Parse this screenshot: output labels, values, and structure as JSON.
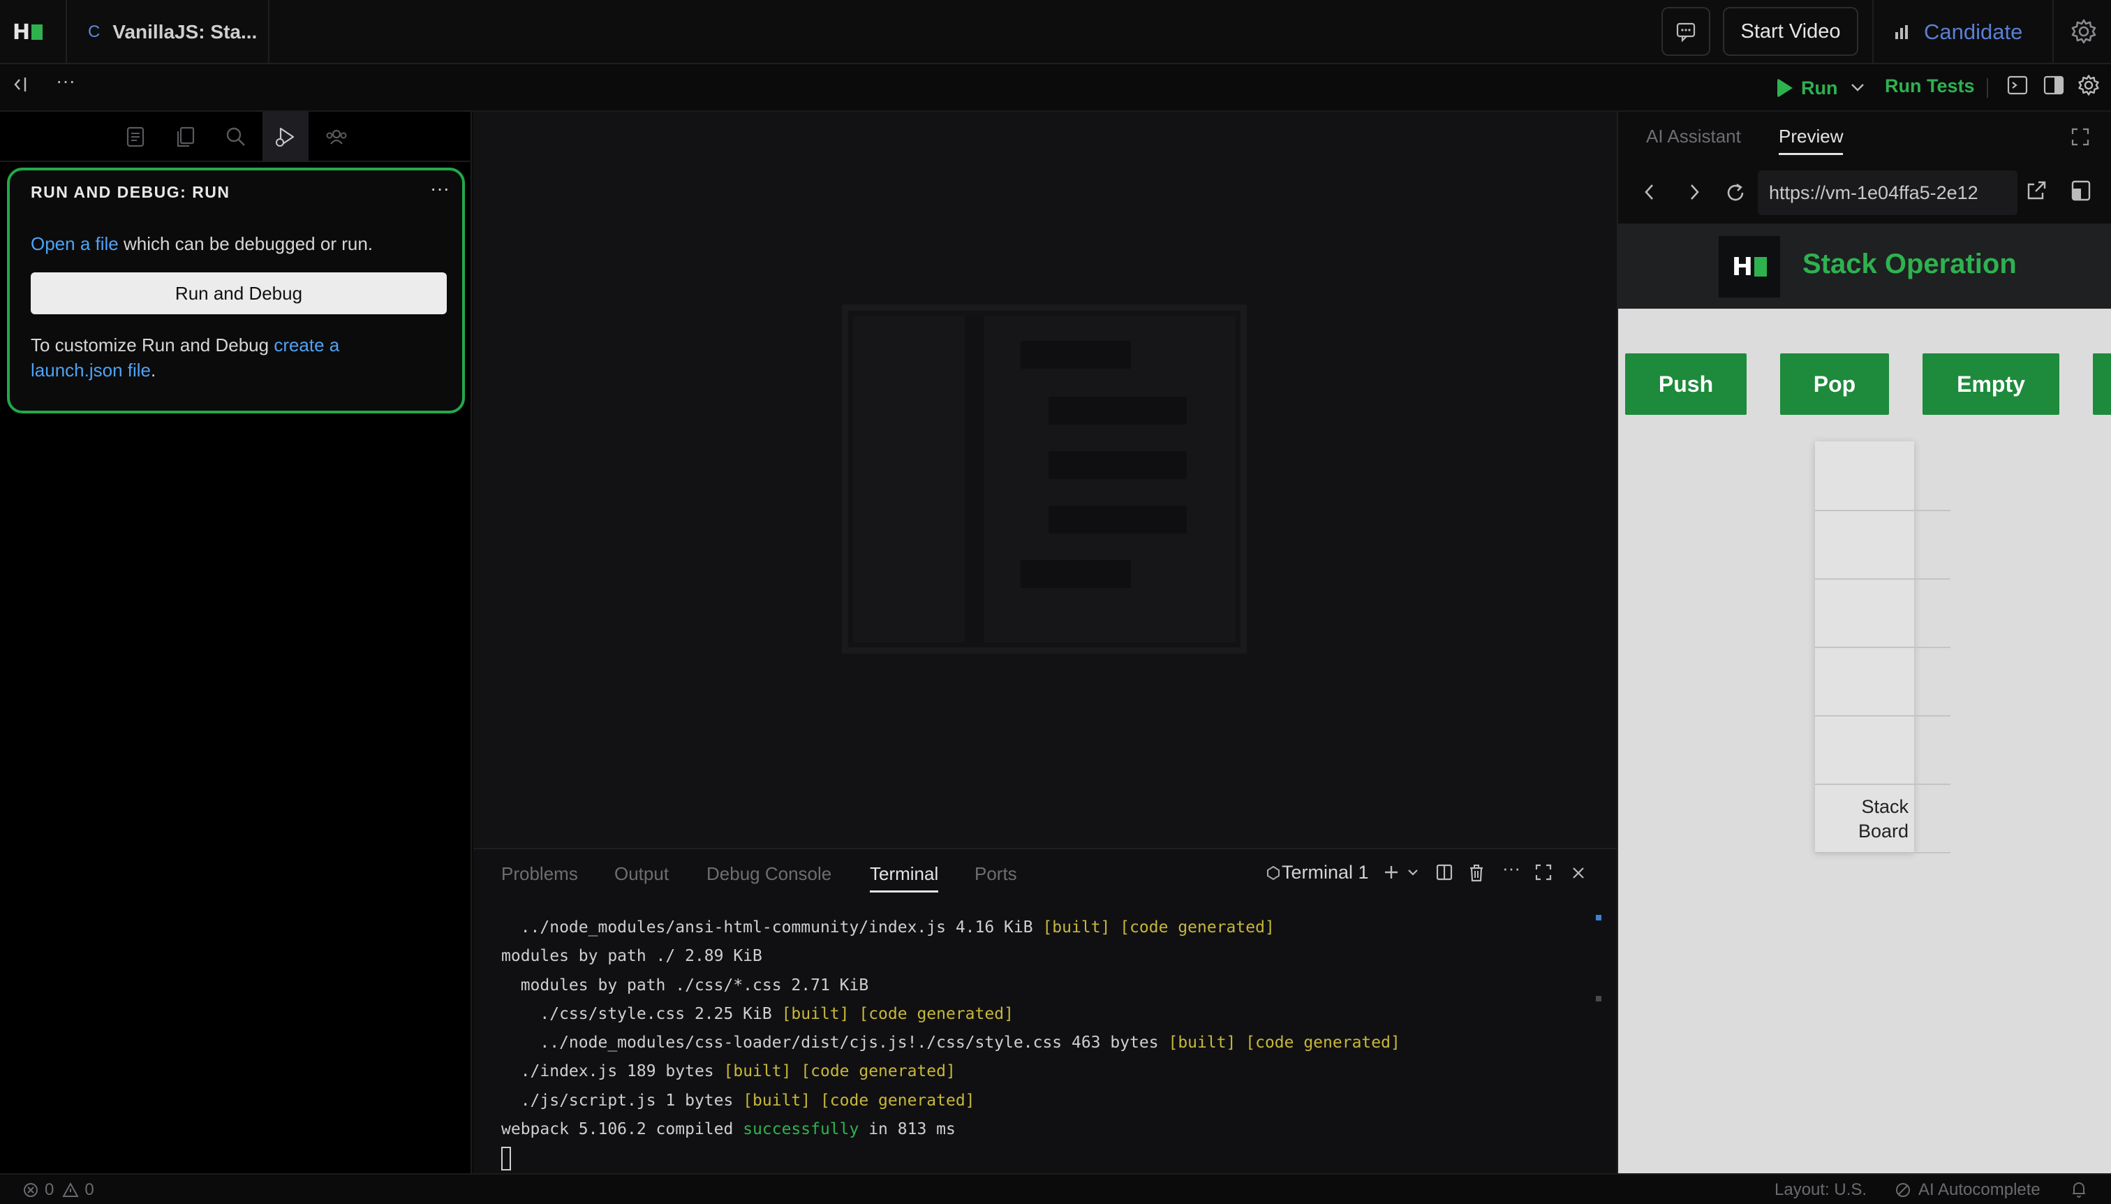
{
  "topbar": {
    "file_tab_icon": "C",
    "file_tab_title": "VanillaJS: Sta...",
    "start_video": "Start Video",
    "candidate": "Candidate"
  },
  "toolbar": {
    "run": "Run",
    "run_tests": "Run Tests"
  },
  "debug_panel": {
    "title": "RUN AND DEBUG: RUN",
    "open_link": "Open a file",
    "open_rest": " which can be debugged or run.",
    "button": "Run and Debug",
    "customize_prefix": "To customize Run and Debug ",
    "customize_link": "create a launch.json file",
    "customize_suffix": "."
  },
  "panel": {
    "tabs": [
      "Problems",
      "Output",
      "Debug Console",
      "Terminal",
      "Ports"
    ],
    "active_tab": "Terminal",
    "terminal_name": "Terminal 1",
    "lines": [
      {
        "text": "  ../node_modules/ansi-html-community/index.js 4.16 KiB ",
        "tag": "[built] [code generated]"
      },
      {
        "text": "modules by path ./ 2.89 KiB",
        "tag": ""
      },
      {
        "text": "  modules by path ./css/*.css 2.71 KiB",
        "tag": ""
      },
      {
        "text": "    ./css/style.css 2.25 KiB ",
        "tag": "[built] [code generated]"
      },
      {
        "text": "    ../node_modules/css-loader/dist/cjs.js!./css/style.css 463 bytes ",
        "tag": "[built] [code generated]"
      },
      {
        "text": "  ./index.js 189 bytes ",
        "tag": "[built] [code generated]"
      },
      {
        "text": "  ./js/script.js 1 bytes ",
        "tag": "[built] [code generated]"
      }
    ],
    "compiled_prefix": "webpack 5.106.2 compiled ",
    "compiled_status": "successfully",
    "compiled_suffix": " in 813 ms"
  },
  "preview": {
    "tabs": [
      "AI Assistant",
      "Preview"
    ],
    "active_tab": "Preview",
    "url": "https://vm-1e04ffa5-2e12",
    "site_title": "Stack Operation",
    "buttons": [
      "Push",
      "Pop",
      "Empty"
    ],
    "stack_label_line1": "Stack",
    "stack_label_line2": "Board"
  },
  "statusbar": {
    "errors": "0",
    "warnings": "0",
    "layout": "Layout: U.S.",
    "autocomplete": "AI Autocomplete"
  },
  "colors": {
    "accent_green": "#2eb24f",
    "link_blue": "#4ea3f4",
    "candidate_blue": "#5a7fd4"
  }
}
